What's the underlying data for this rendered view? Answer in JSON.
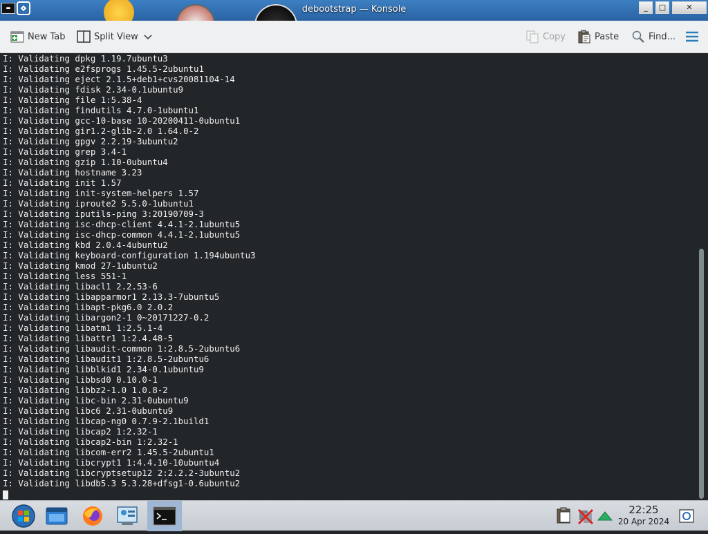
{
  "window": {
    "app_icon_text": "▬",
    "title": "debootstrap — Konsole",
    "buttons": {
      "minimize_glyph": "_",
      "maximize_glyph": "□",
      "close_glyph": "✕"
    }
  },
  "toolbar": {
    "new_tab_label": "New Tab",
    "split_view_label": "Split View",
    "copy_label": "Copy",
    "paste_label": "Paste",
    "find_label": "Find...",
    "icons": [
      "new-tab-icon",
      "split-view-icon",
      "chevron-down-icon",
      "copy-icon",
      "paste-icon",
      "search-icon",
      "hamburger-menu-icon"
    ]
  },
  "terminal": {
    "lines": [
      "I: Validating dpkg 1.19.7ubuntu3",
      "I: Validating e2fsprogs 1.45.5-2ubuntu1",
      "I: Validating eject 2.1.5+deb1+cvs20081104-14",
      "I: Validating fdisk 2.34-0.1ubuntu9",
      "I: Validating file 1:5.38-4",
      "I: Validating findutils 4.7.0-1ubuntu1",
      "I: Validating gcc-10-base 10-20200411-0ubuntu1",
      "I: Validating gir1.2-glib-2.0 1.64.0-2",
      "I: Validating gpgv 2.2.19-3ubuntu2",
      "I: Validating grep 3.4-1",
      "I: Validating gzip 1.10-0ubuntu4",
      "I: Validating hostname 3.23",
      "I: Validating init 1.57",
      "I: Validating init-system-helpers 1.57",
      "I: Validating iproute2 5.5.0-1ubuntu1",
      "I: Validating iputils-ping 3:20190709-3",
      "I: Validating isc-dhcp-client 4.4.1-2.1ubuntu5",
      "I: Validating isc-dhcp-common 4.4.1-2.1ubuntu5",
      "I: Validating kbd 2.0.4-4ubuntu2",
      "I: Validating keyboard-configuration 1.194ubuntu3",
      "I: Validating kmod 27-1ubuntu2",
      "I: Validating less 551-1",
      "I: Validating libacl1 2.2.53-6",
      "I: Validating libapparmor1 2.13.3-7ubuntu5",
      "I: Validating libapt-pkg6.0 2.0.2",
      "I: Validating libargon2-1 0~20171227-0.2",
      "I: Validating libatm1 1:2.5.1-4",
      "I: Validating libattr1 1:2.4.48-5",
      "I: Validating libaudit-common 1:2.8.5-2ubuntu6",
      "I: Validating libaudit1 1:2.8.5-2ubuntu6",
      "I: Validating libblkid1 2.34-0.1ubuntu9",
      "I: Validating libbsd0 0.10.0-1",
      "I: Validating libbz2-1.0 1.0.8-2",
      "I: Validating libc-bin 2.31-0ubuntu9",
      "I: Validating libc6 2.31-0ubuntu9",
      "I: Validating libcap-ng0 0.7.9-2.1build1",
      "I: Validating libcap2 1:2.32-1",
      "I: Validating libcap2-bin 1:2.32-1",
      "I: Validating libcom-err2 1.45.5-2ubuntu1",
      "I: Validating libcrypt1 1:4.4.10-10ubuntu4",
      "I: Validating libcryptsetup12 2:2.2.2-3ubuntu2",
      "I: Validating libdb5.3 5.3.28+dfsg1-0.6ubuntu2"
    ],
    "scroll": {
      "position_fraction": 0.55,
      "visible_fraction": 0.56
    }
  },
  "taskbar": {
    "apps": [
      {
        "name": "start-menu-icon"
      },
      {
        "name": "file-manager-icon"
      },
      {
        "name": "firefox-icon"
      },
      {
        "name": "control-panel-icon"
      },
      {
        "name": "konsole-icon",
        "active": true,
        "glyph": "# >_"
      }
    ],
    "tray_icons": [
      "clipboard-icon",
      "network-disconnected-icon",
      "update-arrow-icon",
      "notifications-icon"
    ],
    "clock": {
      "time": "22:25",
      "date": "20 Apr 2024"
    }
  },
  "colors": {
    "terminal_bg": "#232629",
    "terminal_fg": "#eff0f1",
    "toolbar_bg": "#eff0f1",
    "titlebar": "#2f6fb0",
    "accent": "#3daee9"
  }
}
